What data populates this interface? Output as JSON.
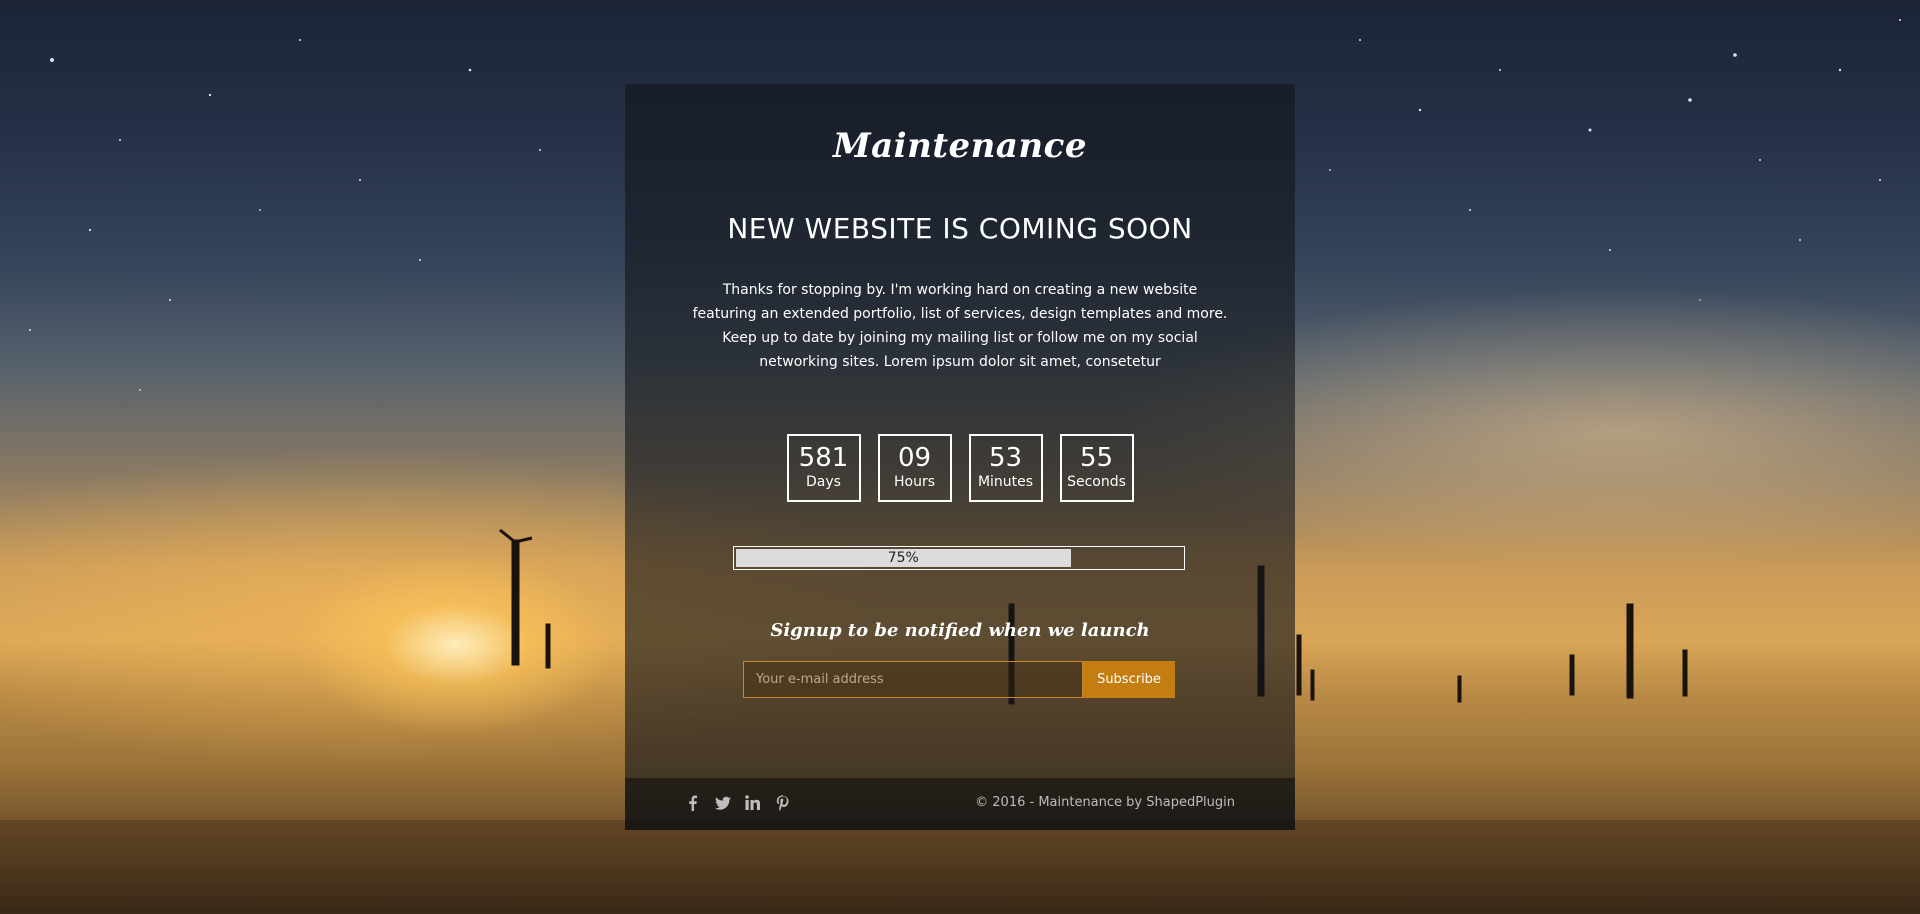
{
  "site": {
    "logo": "Maintenance"
  },
  "hero": {
    "headline": "NEW WEBSITE IS COMING SOON",
    "description": "Thanks for stopping by. I'm working hard on creating a new website featuring an extended portfolio, list of services, design templates and more. Keep up to date by joining my mailing list or follow me on my social networking sites. Lorem ipsum dolor sit amet, consetetur"
  },
  "countdown": {
    "days": {
      "value": "581",
      "label": "Days"
    },
    "hours": {
      "value": "09",
      "label": "Hours"
    },
    "minutes": {
      "value": "53",
      "label": "Minutes"
    },
    "seconds": {
      "value": "55",
      "label": "Seconds"
    }
  },
  "progress": {
    "percent": 75,
    "label": "75%"
  },
  "signup": {
    "heading": "Signup to be notified when we launch",
    "email_placeholder": "Your e-mail address",
    "email_value": "",
    "button_label": "Subscribe"
  },
  "footer": {
    "social_icons": [
      "facebook-icon",
      "twitter-icon",
      "linkedin-icon",
      "pinterest-icon"
    ],
    "copyright": "© 2016 - Maintenance by ShapedPlugin"
  },
  "colors": {
    "accent": "#c47d10",
    "panel": "#14161c",
    "text": "#ffffff"
  }
}
